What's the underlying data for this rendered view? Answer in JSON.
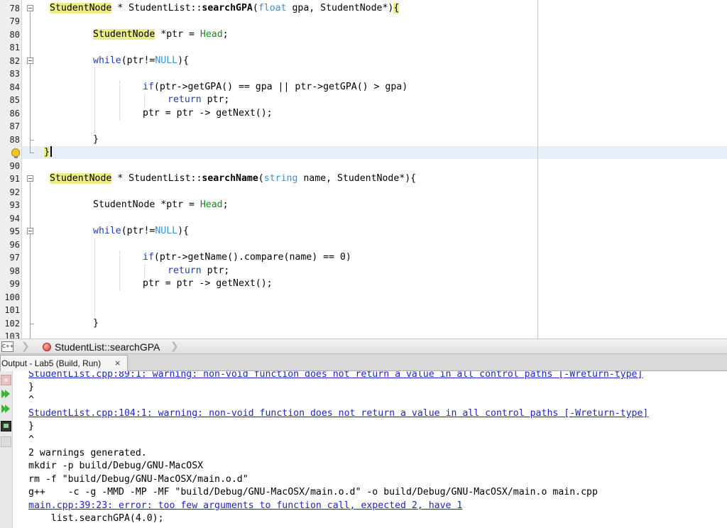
{
  "editor": {
    "line_numbers": [
      "78",
      "79",
      "80",
      "81",
      "82",
      "83",
      "84",
      "85",
      "86",
      "87",
      "88",
      "89",
      "90",
      "91",
      "92",
      "93",
      "94",
      "95",
      "96",
      "97",
      "98",
      "99",
      "100",
      "101",
      "102",
      "103"
    ],
    "tokens": {
      "studentnode": "StudentNode",
      "star_sep": " * ",
      "studentlist_scope": "StudentList::",
      "search_gpa": "searchGPA",
      "paren_open": "(",
      "float_kw": "float",
      "gpa_param_rest": " gpa, StudentNode*)",
      "brace_open": "{",
      "ptr_decl": " *ptr = ",
      "head": "Head",
      "semicolon": ";",
      "while_kw": "while",
      "while_cond_open": "(ptr!=",
      "null_kw": "NULL",
      "while_cond_close": "){",
      "if_kw": "if",
      "if_gpa_cond": "(ptr->getGPA() == gpa || ptr->getGPA() > gpa)",
      "return_kw": "return",
      "return_rest": " ptr;",
      "ptr_next": "ptr = ptr -> getNext();",
      "brace_close": "}",
      "search_name": "searchName",
      "string_kw": "string",
      "name_param_rest": " name, StudentNode*){",
      "studentnode_ptr_decl": "StudentNode *ptr = ",
      "if_name_cond": "(ptr->getName().compare(name) == 0)"
    }
  },
  "breadcrumb": {
    "file_icon": "cpp-file-icon",
    "function_label": "StudentList::searchGPA"
  },
  "output": {
    "tab_label": "Output - Lab5 (Build, Run)",
    "tab_close": "×",
    "lines": [
      "StudentList.cpp:89:1: warning: non-void function does not return a value in all control paths [-Wreturn-type]",
      "}",
      "^",
      "StudentList.cpp:104:1: warning: non-void function does not return a value in all control paths [-Wreturn-type]",
      "}",
      "^",
      "2 warnings generated.",
      "mkdir -p build/Debug/GNU-MacOSX",
      "rm -f \"build/Debug/GNU-MacOSX/main.o.d\"",
      "g++    -c -g -MMD -MP -MF \"build/Debug/GNU-MacOSX/main.o.d\" -o build/Debug/GNU-MacOSX/main.o main.cpp",
      "main.cpp:39:23: error: too few arguments to function call, expected 2, have 1",
      "    list.searchGPA(4.0);"
    ]
  },
  "colors": {
    "keyword": "#1c3fb8",
    "type_keyword": "#3d8fcf",
    "member": "#1a8a1a",
    "highlight": "#ecec8a",
    "link": "#1f23c9"
  }
}
